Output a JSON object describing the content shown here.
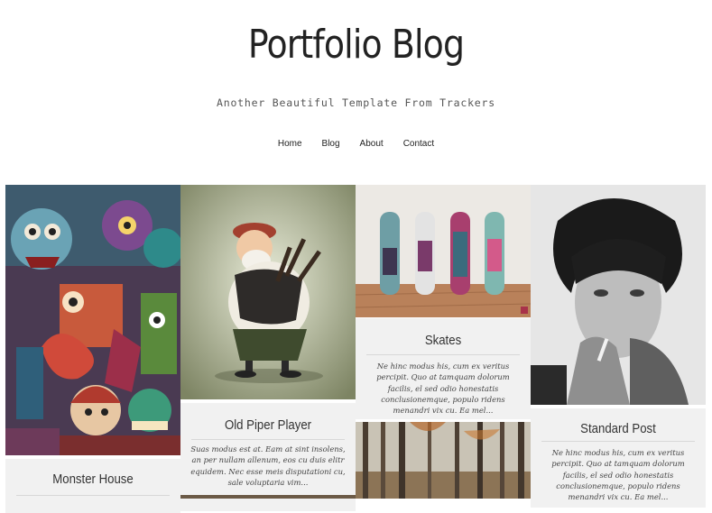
{
  "header": {
    "site_title": "Portfolio Blog",
    "tagline": "Another Beautiful Template From Trackers"
  },
  "nav": {
    "items": [
      "Home",
      "Blog",
      "About",
      "Contact"
    ]
  },
  "posts": [
    {
      "title": "Monster House",
      "excerpt": ""
    },
    {
      "title": "Old Piper Player",
      "excerpt": "Suas modus est at. Eam at sint insolens, an per nullam allenum, eos cu duis elitr equidem. Nec esse meis disputationi cu, sale voluptaria vim..."
    },
    {
      "title": "Skates",
      "excerpt": "Ne hinc modus his, cum ex veritus percipit. Quo at tamquam dolorum facilis, el sed odio honestatis conclusionemque, populo ridens menandri vix cu. Ea mel..."
    },
    {
      "title": "Standard Post",
      "excerpt": "Ne hinc modus his, cum ex veritus percipit. Quo at tamquam dolorum facilis, el sed odio honestatis conclusionemque, populo ridens menandri vix cu. Ea mel..."
    }
  ],
  "theme": {
    "card_bg": "#f1f1f1",
    "text": "#222222"
  }
}
